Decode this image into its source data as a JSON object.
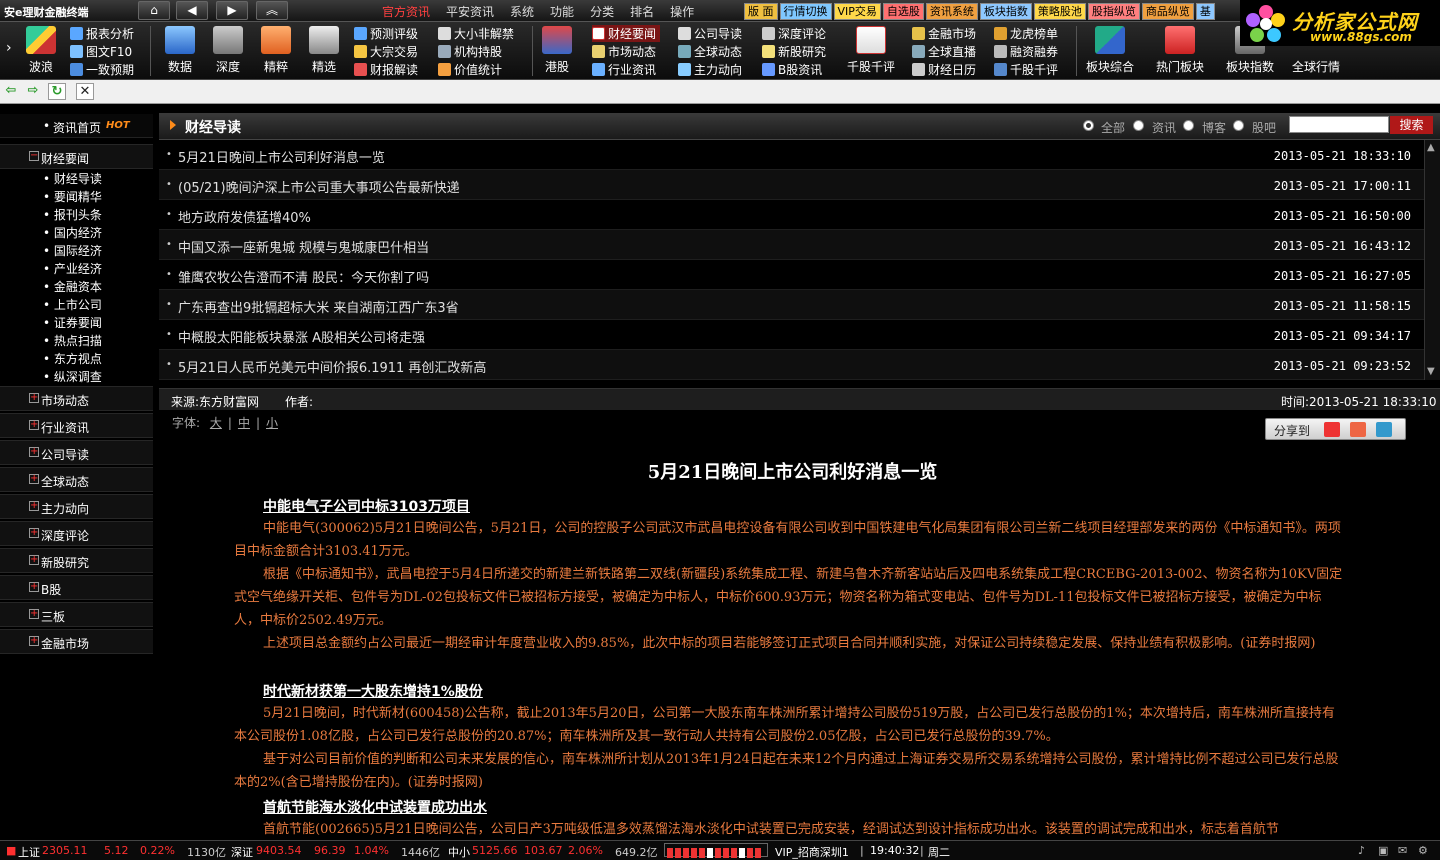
{
  "app": {
    "title": "安e理财金融终端"
  },
  "titlebar": {
    "nav_icons": [
      "home-icon",
      "back-icon",
      "forward-icon",
      "collapse-icon"
    ],
    "menu": [
      {
        "label": "官方资讯",
        "active": true
      },
      {
        "label": "平安资讯",
        "active": false
      },
      {
        "label": "系统",
        "active": false
      },
      {
        "label": "功能",
        "active": false
      },
      {
        "label": "分类",
        "active": false
      },
      {
        "label": "排名",
        "active": false
      },
      {
        "label": "操作",
        "active": false
      }
    ],
    "quick_tabs": [
      "版 面",
      "行情切换",
      "VIP交易",
      "自选股",
      "资讯系统",
      "板块指数",
      "策略股池",
      "股指纵览",
      "商品纵览",
      "基"
    ]
  },
  "logo": {
    "text": "分析家公式网",
    "url": "www.88gs.com"
  },
  "toolbar": {
    "big_buttons": [
      "波浪",
      "数据",
      "深度",
      "精粹",
      "精选",
      "港股",
      "千股千评",
      "板块综合",
      "热门板块",
      "板块指数",
      "全球行情"
    ],
    "col1": [
      "报表分析",
      "图文F10",
      "一致预期"
    ],
    "col2": [
      "预测评级",
      "大宗交易",
      "财报解读"
    ],
    "col3": [
      "大小非解禁",
      "机构持股",
      "价值统计"
    ],
    "col4": [
      "财经要闻",
      "市场动态",
      "行业资讯"
    ],
    "col5": [
      "公司导读",
      "全球动态",
      "主力动向"
    ],
    "col6": [
      "深度评论",
      "新股研究",
      "B股资讯"
    ],
    "col7": [
      "金融市场",
      "全球直播",
      "财经日历"
    ],
    "col8": [
      "龙虎榜单",
      "融资融券",
      "千股千评"
    ]
  },
  "navbar": {
    "icons": [
      "back-arrow-icon",
      "forward-arrow-icon",
      "refresh-icon",
      "stop-icon"
    ]
  },
  "sidebar": {
    "top": {
      "label": "资讯首页",
      "badge": "HOT"
    },
    "expanded_group": "财经要闻",
    "sub_items": [
      "财经导读",
      "要闻精华",
      "报刊头条",
      "国内经济",
      "国际经济",
      "产业经济",
      "金融资本",
      "上市公司",
      "证券要闻",
      "热点扫描",
      "东方视点",
      "纵深调查"
    ],
    "groups": [
      "市场动态",
      "行业资讯",
      "公司导读",
      "全球动态",
      "主力动向",
      "深度评论",
      "新股研究",
      "B股",
      "三板",
      "金融市场"
    ]
  },
  "list": {
    "title": "财经导读",
    "filters": [
      {
        "label": "全部",
        "selected": true
      },
      {
        "label": "资讯",
        "selected": false
      },
      {
        "label": "博客",
        "selected": false
      },
      {
        "label": "股吧",
        "selected": false
      }
    ],
    "search_value": "",
    "search_button": "搜索",
    "rows": [
      {
        "title": "5月21日晚间上市公司利好消息一览",
        "time": "2013-05-21 18:33:10"
      },
      {
        "title": "(05/21)晚间沪深上市公司重大事项公告最新快递",
        "time": "2013-05-21 17:00:11"
      },
      {
        "title": "地方政府发债猛增40%",
        "time": "2013-05-21 16:50:00"
      },
      {
        "title": "中国又添一座新鬼城 规模与鬼城康巴什相当",
        "time": "2013-05-21 16:43:12"
      },
      {
        "title": "雏鹰农牧公告澄而不清 股民：今天你割了吗",
        "time": "2013-05-21 16:27:05"
      },
      {
        "title": "广东再查出9批镉超标大米 来自湖南江西广东3省",
        "time": "2013-05-21 11:58:15"
      },
      {
        "title": "中概股太阳能板块暴涨 A股相关公司将走强",
        "time": "2013-05-21 09:34:17"
      },
      {
        "title": "5月21日人民币兑美元中间价报6.1911 再创汇改新高",
        "time": "2013-05-21 09:23:52"
      }
    ]
  },
  "article": {
    "source": "来源:东方财富网",
    "author": "作者:",
    "time": "时间:2013-05-21 18:33:10",
    "font_label": "字体:",
    "font_sizes": [
      "大",
      "中",
      "小"
    ],
    "share_label": "分享到",
    "title": "5月21日晚间上市公司利好消息一览",
    "sections": [
      {
        "heading": "中能电气子公司中标3103万项目",
        "paras": [
          "中能电气(300062)5月21日晚间公告，5月21日，公司的控股子公司武汉市武昌电控设备有限公司收到中国铁建电气化局集团有限公司兰新二线项目经理部发来的两份《中标通知书》。两项目中标金额合计3103.41万元。",
          "根据《中标通知书》，武昌电控于5月4日所递交的新建兰新铁路第二双线(新疆段)系统集成工程、新建乌鲁木齐新客站站后及四电系统集成工程CRCEBG-2013-002、物资名称为10KV固定式空气绝缘开关柜、包件号为DL-02包投标文件已被招标方接受，被确定为中标人，中标价600.93万元；物资名称为箱式变电站、包件号为DL-11包投标文件已被招标方接受，被确定为中标人，中标价2502.49万元。",
          "上述项目总金额约占公司最近一期经审计年度营业收入的9.85%，此次中标的项目若能够签订正式项目合同并顺利实施，对保证公司持续稳定发展、保持业绩有积极影响。(证券时报网)"
        ]
      },
      {
        "heading": "时代新材获第一大股东增持1%股份",
        "paras": [
          "5月21日晚间，时代新材(600458)公告称，截止2013年5月20日，公司第一大股东南车株洲所累计增持公司股份519万股，占公司已发行总股份的1%；本次增持后，南车株洲所直接持有本公司股份1.08亿股，占公司已发行总股份的20.87%；南车株洲所及其一致行动人共持有公司股份2.05亿股，占公司已发行总股份的39.7%。",
          "基于对公司目前价值的判断和公司未来发展的信心，南车株洲所计划从2013年1月24日起在未来12个月内通过上海证券交易所交易系统增持公司股份，累计增持比例不超过公司已发行总股本的2%(含已增持股份在内)。(证券时报网)"
        ]
      },
      {
        "heading": "首航节能海水淡化中试装置成功出水",
        "paras": [
          "首航节能(002665)5月21日晚间公告，公司日产3万吨级低温多效蒸馏法海水淡化中试装置已完成安装，经调试达到设计指标成功出水。该装置的调试完成和出水，标志着首航节"
        ]
      }
    ]
  },
  "statusbar": {
    "sh_label": "上证",
    "sh_value": "2305.11",
    "sh_change": "5.12",
    "sh_pct": "0.22%",
    "sh_amount": "1130亿",
    "sz_label": "深证",
    "sz_value": "9403.54",
    "sz_change": "96.39",
    "sz_pct": "1.04%",
    "sz_amount": "1446亿",
    "zx_label": "中小",
    "zx_value": "5125.66",
    "zx_change": "103.67",
    "zx_pct": "2.06%",
    "zx_amount": "649.2亿",
    "broker": "VIP_招商深圳1",
    "clock": "19:40:32",
    "weekday": "周二"
  },
  "colors": {
    "up": "#ff3030",
    "article_text": "#e87a3f",
    "highlight_tab": "#7a1515",
    "accent": "#ff8c1a"
  }
}
